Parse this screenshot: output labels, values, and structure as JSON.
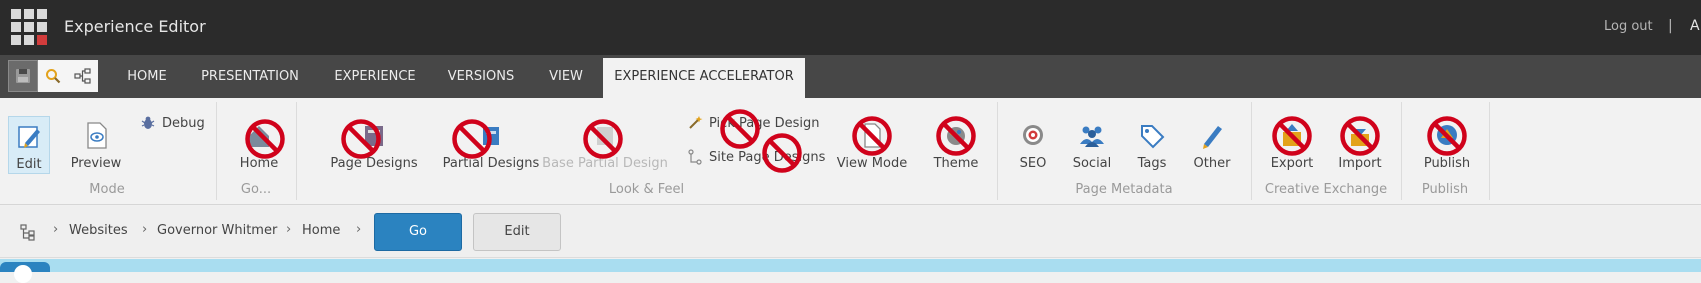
{
  "app": {
    "title": "Experience Editor",
    "logout": "Log out",
    "separator": "|",
    "user_initial": "A"
  },
  "tabs": [
    {
      "label": "HOME"
    },
    {
      "label": "PRESENTATION"
    },
    {
      "label": "EXPERIENCE"
    },
    {
      "label": "VERSIONS"
    },
    {
      "label": "VIEW"
    },
    {
      "label": "EXPERIENCE ACCELERATOR",
      "active": true
    }
  ],
  "ribbon": {
    "mode": {
      "label": "Mode",
      "edit": "Edit",
      "preview": "Preview",
      "debug": "Debug"
    },
    "go": {
      "label": "Go...",
      "home": "Home"
    },
    "look_feel": {
      "label": "Look & Feel",
      "page_designs": "Page Designs",
      "partial_designs": "Partial Designs",
      "base_partial_design": "Base Partial Design",
      "pick_page_design": "Pick Page Design",
      "site_page_designs": "Site Page Designs",
      "view_mode": "View Mode",
      "theme": "Theme"
    },
    "page_metadata": {
      "label": "Page Metadata",
      "seo": "SEO",
      "social": "Social",
      "tags": "Tags",
      "other": "Other"
    },
    "creative_exchange": {
      "label": "Creative Exchange",
      "export": "Export",
      "import": "Import"
    },
    "publish": {
      "label": "Publish",
      "publish": "Publish"
    }
  },
  "breadcrumb": {
    "items": [
      "Websites",
      "Governor Whitmer",
      "Home"
    ],
    "go_button": "Go",
    "edit_button": "Edit"
  },
  "colors": {
    "accent": "#2b83c0",
    "topbar": "#2b2b2b",
    "tabbar": "#474747",
    "prohibited": "#d0021b"
  },
  "icons": {
    "app": "app-grid-icon",
    "save": "save-icon",
    "search": "search-icon",
    "tree": "tree-icon",
    "edit": "edit-icon",
    "preview": "preview-icon",
    "debug": "debug-icon",
    "prohibited": "prohibited-icon"
  }
}
